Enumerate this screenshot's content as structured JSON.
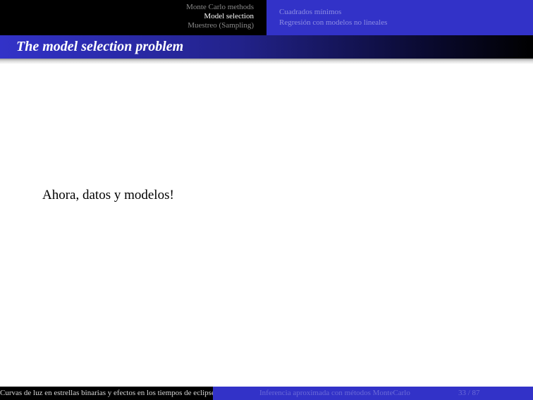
{
  "header": {
    "sections": [
      {
        "label": "Monte Carlo methods",
        "active": false
      },
      {
        "label": "Model selection",
        "active": true
      },
      {
        "label": "Muestreo (Sampling)",
        "active": false
      }
    ],
    "subsections": [
      {
        "label": "Cuadrados mínimos"
      },
      {
        "label": "Regresión con modelos no lineales"
      }
    ]
  },
  "frame": {
    "title": "The model selection problem",
    "body": "Ahora, datos y modelos!"
  },
  "footer": {
    "author_title": "Curvas de luz en estrellas binarias y efectos en los tiempos de eclipse",
    "short_title": "Inferencia aproximada con métodos MonteCarlo",
    "page": "33 / 87"
  },
  "colors": {
    "beamer_blue": "#3232c8",
    "black": "#000000",
    "inactive_text": "#8a8a8a"
  }
}
